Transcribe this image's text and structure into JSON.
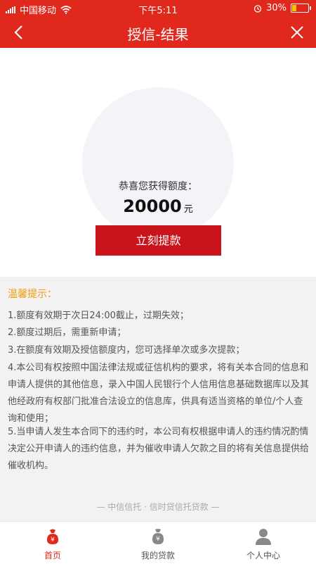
{
  "status_bar": {
    "carrier": "中国移动",
    "time": "下午5:11",
    "battery": "30%",
    "battery_level": 0.3
  },
  "header": {
    "title": "授信-结果",
    "back_icon": "chevron-left-icon",
    "close_icon": "close-icon"
  },
  "result": {
    "label": "恭喜您获得额度：",
    "amount": "20000",
    "unit": "元"
  },
  "actions": {
    "withdraw_label": "立刻提款"
  },
  "tips": {
    "title": "温馨提示：",
    "items": [
      "1.额度有效期于次日24:00截止，过期失效；",
      "2.额度过期后，需重新申请；",
      "3.在额度有效期及授信额度内，您可选择单次或多次提款；",
      "4.本公司有权按照中国法律法规或征信机构的要求，将有关本合同的信息和申请人提供的其他信息，录入中国人民银行个人信用信息基础数据库以及其他经政府有权部门批准合法设立的信息库，供具有适当资格的单位/个人查询和使用；",
      "5.当申请人发生本合同下的违约时，本公司有权根据申请人的违约情况酌情决定公开申请人的违约信息，并为催收申请人欠款之目的将有关信息提供给催收机构。"
    ],
    "footer": "— 中信信托 · 信时贷信托贷款 —"
  },
  "tabbar": {
    "items": [
      {
        "label": "首页",
        "icon": "home-moneybag-icon",
        "active": true
      },
      {
        "label": "我的贷款",
        "icon": "money-bag-icon",
        "active": false
      },
      {
        "label": "个人中心",
        "icon": "person-icon",
        "active": false
      }
    ]
  },
  "colors": {
    "primary": "#e0281d",
    "button": "#c9141b",
    "tip_title": "#f39c12"
  }
}
